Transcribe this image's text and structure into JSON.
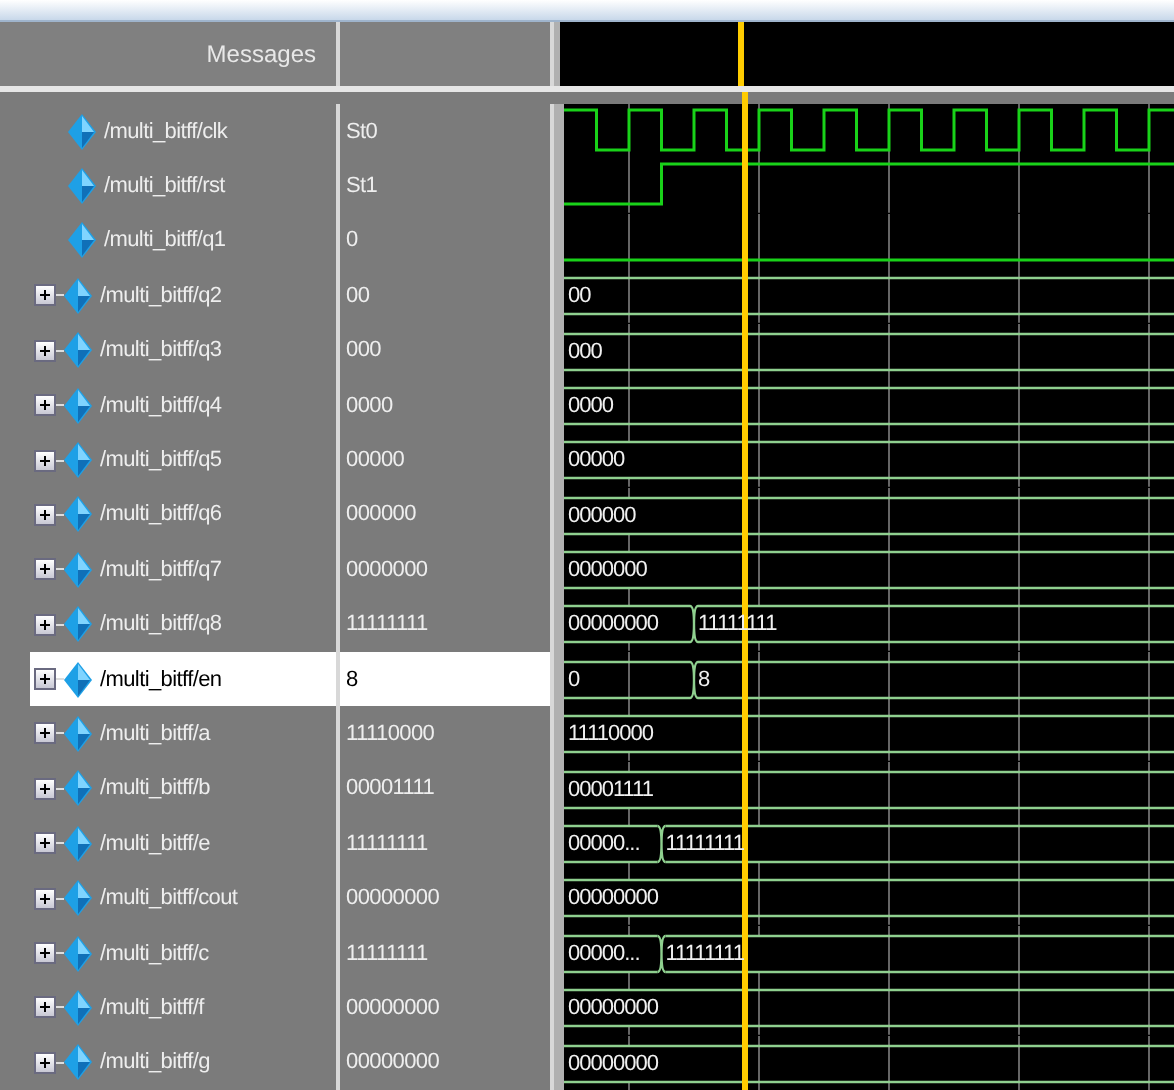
{
  "header": {
    "name_column": "Messages"
  },
  "signals": [
    {
      "name": "/multi_bitff/clk",
      "value": "St0",
      "kind": "clock",
      "expandable": false,
      "selected": false
    },
    {
      "name": "/multi_bitff/rst",
      "value": "St1",
      "kind": "bit",
      "expandable": false,
      "selected": false
    },
    {
      "name": "/multi_bitff/q1",
      "value": "0",
      "kind": "bit",
      "expandable": false,
      "selected": false
    },
    {
      "name": "/multi_bitff/q2",
      "value": "00",
      "kind": "bus",
      "expandable": true,
      "selected": false,
      "segments": [
        "00"
      ]
    },
    {
      "name": "/multi_bitff/q3",
      "value": "000",
      "kind": "bus",
      "expandable": true,
      "selected": false,
      "segments": [
        "000"
      ]
    },
    {
      "name": "/multi_bitff/q4",
      "value": "0000",
      "kind": "bus",
      "expandable": true,
      "selected": false,
      "segments": [
        "0000"
      ]
    },
    {
      "name": "/multi_bitff/q5",
      "value": "00000",
      "kind": "bus",
      "expandable": true,
      "selected": false,
      "segments": [
        "00000"
      ]
    },
    {
      "name": "/multi_bitff/q6",
      "value": "000000",
      "kind": "bus",
      "expandable": true,
      "selected": false,
      "segments": [
        "000000"
      ]
    },
    {
      "name": "/multi_bitff/q7",
      "value": "0000000",
      "kind": "bus",
      "expandable": true,
      "selected": false,
      "segments": [
        "0000000"
      ]
    },
    {
      "name": "/multi_bitff/q8",
      "value": "11111111",
      "kind": "bus",
      "expandable": true,
      "selected": false,
      "segments": [
        "00000000",
        "11111111"
      ]
    },
    {
      "name": "/multi_bitff/en",
      "value": "8",
      "kind": "bus",
      "expandable": true,
      "selected": true,
      "segments": [
        "0",
        "8"
      ]
    },
    {
      "name": "/multi_bitff/a",
      "value": "11110000",
      "kind": "bus",
      "expandable": true,
      "selected": false,
      "segments": [
        "11110000"
      ]
    },
    {
      "name": "/multi_bitff/b",
      "value": "00001111",
      "kind": "bus",
      "expandable": true,
      "selected": false,
      "segments": [
        "00001111"
      ]
    },
    {
      "name": "/multi_bitff/e",
      "value": "11111111",
      "kind": "bus",
      "expandable": true,
      "selected": false,
      "segments": [
        "00000...",
        "11111111"
      ]
    },
    {
      "name": "/multi_bitff/cout",
      "value": "00000000",
      "kind": "bus",
      "expandable": true,
      "selected": false,
      "segments": [
        "00000000"
      ]
    },
    {
      "name": "/multi_bitff/c",
      "value": "11111111",
      "kind": "bus",
      "expandable": true,
      "selected": false,
      "segments": [
        "00000...",
        "11111111"
      ]
    },
    {
      "name": "/multi_bitff/f",
      "value": "00000000",
      "kind": "bus",
      "expandable": true,
      "selected": false,
      "segments": [
        "00000000"
      ]
    },
    {
      "name": "/multi_bitff/g",
      "value": "00000000",
      "kind": "bus",
      "expandable": true,
      "selected": false,
      "segments": [
        "00000000"
      ]
    }
  ]
}
